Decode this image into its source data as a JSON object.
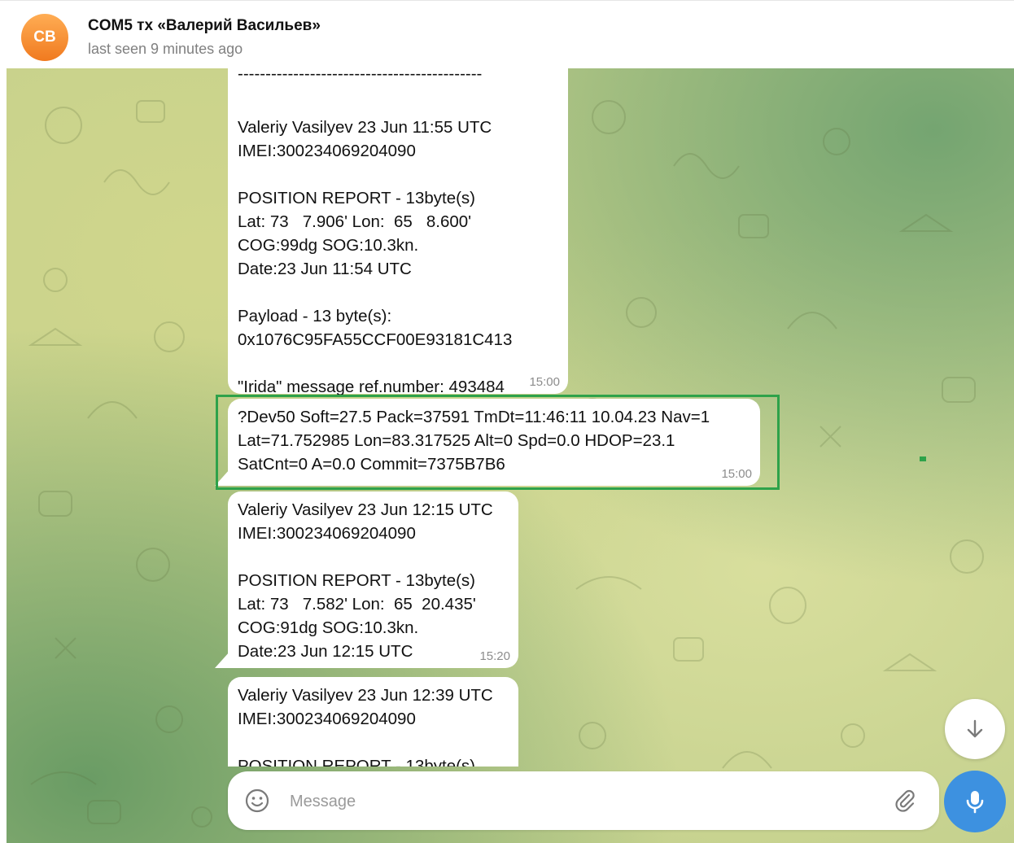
{
  "header": {
    "avatar_initials": "CB",
    "title": "COM5 тх «Валерий Васильев»",
    "status": "last seen 9 minutes ago"
  },
  "messages": [
    {
      "lines": [
        "--------------------------------------------",
        "",
        "Valeriy Vasilyev 23 Jun 11:55 UTC",
        "IMEI:300234069204090",
        "",
        "POSITION REPORT - 13byte(s)",
        "Lat: 73   7.906' Lon:  65   8.600'",
        "COG:99dg SOG:10.3kn.",
        "Date:23 Jun 11:54 UTC",
        "",
        "Payload - 13 byte(s):",
        "0x1076C95FA55CCF00E93181C413",
        "",
        "\"Irida\" message ref.number: 493484"
      ],
      "time": "15:00"
    },
    {
      "lines": [
        "?Dev50 Soft=27.5 Pack=37591 TmDt=11:46:11 10.04.23 Nav=1",
        "Lat=71.752985 Lon=83.317525 Alt=0 Spd=0.0 HDOP=23.1",
        "SatCnt=0 A=0.0 Commit=7375B7B6"
      ],
      "time": "15:00"
    },
    {
      "lines": [
        "Valeriy Vasilyev 23 Jun 12:15 UTC",
        "IMEI:300234069204090",
        "",
        "POSITION REPORT - 13byte(s)",
        "Lat: 73   7.582' Lon:  65  20.435'",
        "COG:91dg SOG:10.3kn.",
        "Date:23 Jun 12:15 UTC"
      ],
      "time": "15:20"
    },
    {
      "lines": [
        "Valeriy Vasilyev 23 Jun 12:39 UTC",
        "IMEI:300234069204090",
        "",
        "POSITION REPORT - 13byte(s)"
      ]
    }
  ],
  "composer": {
    "placeholder": "Message"
  },
  "icons": {
    "emoji": "smiley-icon",
    "attach": "paperclip-icon",
    "mic": "microphone-icon",
    "scroll": "arrow-down-icon"
  },
  "colors": {
    "accent": "#3d91e0",
    "highlight": "#2ea24a",
    "avatar": "#f07a1f"
  }
}
